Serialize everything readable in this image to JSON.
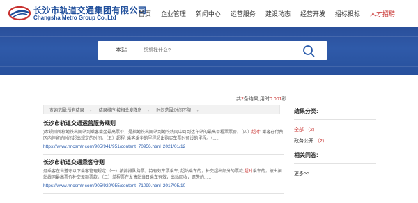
{
  "header": {
    "logo_cn": "长沙市轨道交通集团有限公司",
    "logo_en": "Changsha Metro Group Co.,Ltd",
    "nav": [
      {
        "label": "首页"
      },
      {
        "label": "企业管理"
      },
      {
        "label": "新闻中心"
      },
      {
        "label": "运营服务"
      },
      {
        "label": "建设动态"
      },
      {
        "label": "经营开发"
      },
      {
        "label": "招标投标"
      },
      {
        "label": "人才招聘"
      }
    ],
    "accent_color": "#c8312f",
    "brand_color": "#1f4e9b"
  },
  "search": {
    "scope": "本站",
    "placeholder": "您想找什么?",
    "button_icon": "search-icon"
  },
  "results": {
    "count_prefix": "共",
    "count": "2",
    "count_mid": "条结果,用时",
    "time": "0.001",
    "time_unit": "秒",
    "filters": [
      {
        "label": "查询范围:",
        "value": "所有结果"
      },
      {
        "label": "结果排序:",
        "value": "按相关度降序"
      },
      {
        "label": "时间范围:",
        "value": "时间不限"
      }
    ],
    "items": [
      {
        "title": "长沙市轨道交通运营服务规则",
        "snippet_pre": ")本规则所称地铁出闸站到乘客乘坐最高票价，是指地铁出闸站到地铁线网中可到达车站的最高单程票票价。（四）",
        "snippet_hl": "超时",
        "snippet_post": ": 乘客在付费区内停留的时间超出规定的时间。（五）超程: 乘客乘坐的里程超出购买车票时预设的里程。（......",
        "url": "https://www.hncsmtr.com/905/941/951/content_70956.html",
        "date": "2021/01/12"
      },
      {
        "title": "长沙市轨道交通乘客守则",
        "snippet_pre": "务乘客在当遵守以下乘客管理规定:（一）按排排队购票，持有效车票乘车; 超站乘车的，补交超出部分的票款;",
        "snippet_hl": "超时",
        "snippet_post": "乘车的，按出闸站线网最高票价补交差额票款。（二）单程票在发售站当日乘车有效，出站回收，遗失的......",
        "url": "https://www.hncsmtr.com/905/920/955/content_71099.html",
        "date": "2017/05/10"
      }
    ]
  },
  "sidebar": {
    "classify_title": "结果分类:",
    "categories": [
      {
        "name": "全部",
        "count": "（2）"
      },
      {
        "name": "政务公开",
        "count": "（2）"
      }
    ],
    "related_title": "相关问答:",
    "more": "更多>>"
  }
}
